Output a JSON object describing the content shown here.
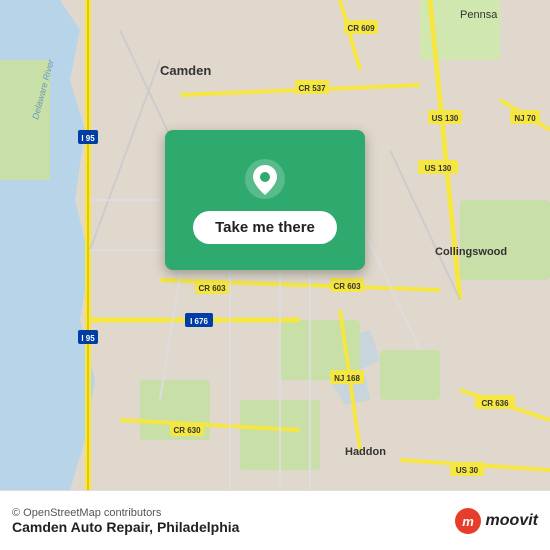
{
  "map": {
    "background_color": "#e8e0d8",
    "center": "Camden, NJ"
  },
  "card": {
    "button_label": "Take me there",
    "background_color": "#2eaa6e"
  },
  "bottom_bar": {
    "osm_credit": "© OpenStreetMap contributors",
    "location_name": "Camden Auto Repair",
    "location_city": "Philadelphia",
    "logo_text": "moovit"
  }
}
